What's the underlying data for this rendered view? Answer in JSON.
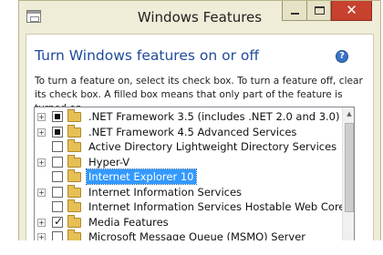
{
  "window": {
    "title": "Windows Features",
    "app_icon": "windows-features-icon",
    "controls": {
      "minimize": "minimize-icon",
      "maximize": "maximize-icon",
      "close": "close-icon",
      "close_glyph": "✕"
    }
  },
  "page": {
    "heading": "Turn Windows features on or off",
    "help_glyph": "?",
    "description": "To turn a feature on, select its check box. To turn a feature off, clear its check box. A filled box means that only part of the feature is turned on."
  },
  "features": [
    {
      "label": ".NET Framework 3.5 (includes .NET 2.0 and 3.0)",
      "state": "partial",
      "expandable": true,
      "selected": false
    },
    {
      "label": ".NET Framework 4.5 Advanced Services",
      "state": "partial",
      "expandable": true,
      "selected": false
    },
    {
      "label": "Active Directory Lightweight Directory Services",
      "state": "unchecked",
      "expandable": false,
      "selected": false
    },
    {
      "label": "Hyper-V",
      "state": "unchecked",
      "expandable": true,
      "selected": false
    },
    {
      "label": "Internet Explorer 10",
      "state": "unchecked",
      "expandable": false,
      "selected": true
    },
    {
      "label": "Internet Information Services",
      "state": "unchecked",
      "expandable": true,
      "selected": false
    },
    {
      "label": "Internet Information Services Hostable Web Core",
      "state": "unchecked",
      "expandable": false,
      "selected": false
    },
    {
      "label": "Media Features",
      "state": "checked",
      "expandable": true,
      "selected": false
    },
    {
      "label": "Microsoft Message Queue (MSMQ) Server",
      "state": "unchecked",
      "expandable": true,
      "selected": false
    }
  ],
  "glyphs": {
    "expand": "+",
    "check": "✓",
    "scroll_up": "▲"
  },
  "colors": {
    "heading": "#1e4a9b",
    "selection": "#3399ff",
    "close_button": "#c7412f",
    "folder": "#e6bf55",
    "frame": "#efecd7"
  }
}
